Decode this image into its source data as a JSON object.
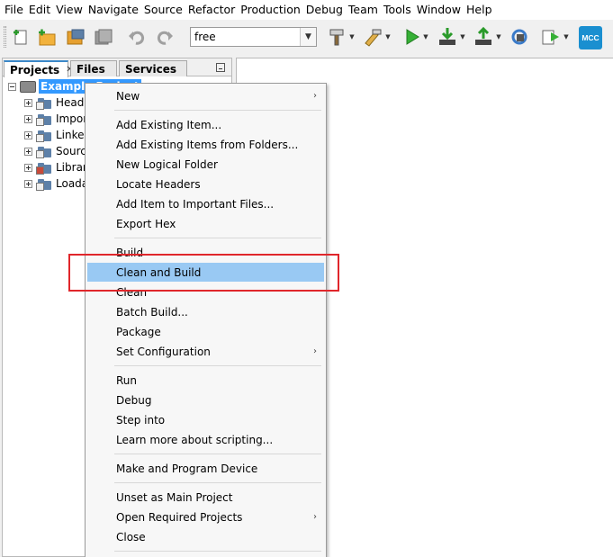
{
  "menubar": [
    "File",
    "Edit",
    "View",
    "Navigate",
    "Source",
    "Refactor",
    "Production",
    "Debug",
    "Team",
    "Tools",
    "Window",
    "Help"
  ],
  "toolbar": {
    "config_value": "free",
    "mcc_label": "MCC",
    "icons": [
      "new-file-icon",
      "new-project-icon",
      "open-project-icon",
      "save-all-icon",
      "undo-icon",
      "redo-icon",
      "build-hammer-icon",
      "clean-build-icon",
      "run-icon",
      "program-device-icon",
      "read-device-icon",
      "refresh-icon",
      "debug-project-icon",
      "mcc-icon"
    ]
  },
  "panel": {
    "tabs": [
      "Projects",
      "Files",
      "Services"
    ],
    "project_name": "Example Project",
    "tree_items": [
      "Header Files",
      "Important Files",
      "Linker Files",
      "Source Files",
      "Libraries",
      "Loadables"
    ]
  },
  "context_menu": {
    "groups": [
      [
        {
          "label": "New",
          "submenu": true
        }
      ],
      [
        {
          "label": "Add Existing Item..."
        },
        {
          "label": "Add Existing Items from Folders..."
        },
        {
          "label": "New Logical Folder"
        },
        {
          "label": "Locate Headers"
        },
        {
          "label": "Add Item to Important Files..."
        },
        {
          "label": "Export Hex"
        }
      ],
      [
        {
          "label": "Build"
        },
        {
          "label": "Clean and Build",
          "highlighted": true
        },
        {
          "label": "Clean"
        },
        {
          "label": "Batch Build..."
        },
        {
          "label": "Package"
        },
        {
          "label": "Set Configuration",
          "submenu": true
        }
      ],
      [
        {
          "label": "Run"
        },
        {
          "label": "Debug"
        },
        {
          "label": "Step into"
        },
        {
          "label": "Learn more about scripting..."
        }
      ],
      [
        {
          "label": "Make and Program Device"
        }
      ],
      [
        {
          "label": "Unset as Main Project"
        },
        {
          "label": "Open Required Projects",
          "submenu": true
        },
        {
          "label": "Close"
        }
      ]
    ]
  },
  "colors": {
    "selection_blue": "#3399ff",
    "menu_highlight": "#99c9f3",
    "annotation_red": "#e0262b",
    "mcc_blue": "#1a8fd0"
  }
}
